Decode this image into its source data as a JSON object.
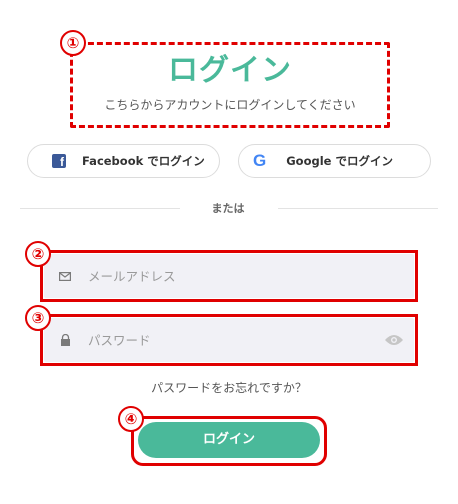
{
  "header": {
    "title": "ログイン",
    "subtitle": "こちらからアカウントにログインしてください"
  },
  "social": {
    "facebook_label": "Facebook でログイン",
    "google_label": "Google でログイン"
  },
  "divider": {
    "text": "または"
  },
  "form": {
    "email_placeholder": "メールアドレス",
    "password_placeholder": "パスワード"
  },
  "forgot_link": "パスワードをお忘れですか？",
  "submit_label": "ログイン",
  "annotations": [
    "①",
    "②",
    "③",
    "④"
  ],
  "colors": {
    "accent": "#4ab99a",
    "annotation": "#e00000",
    "facebook": "#3b5998"
  },
  "icons": {
    "facebook": "facebook-icon",
    "google": "google-icon",
    "email": "mail-icon",
    "password": "lock-icon",
    "toggle": "eye-icon"
  }
}
